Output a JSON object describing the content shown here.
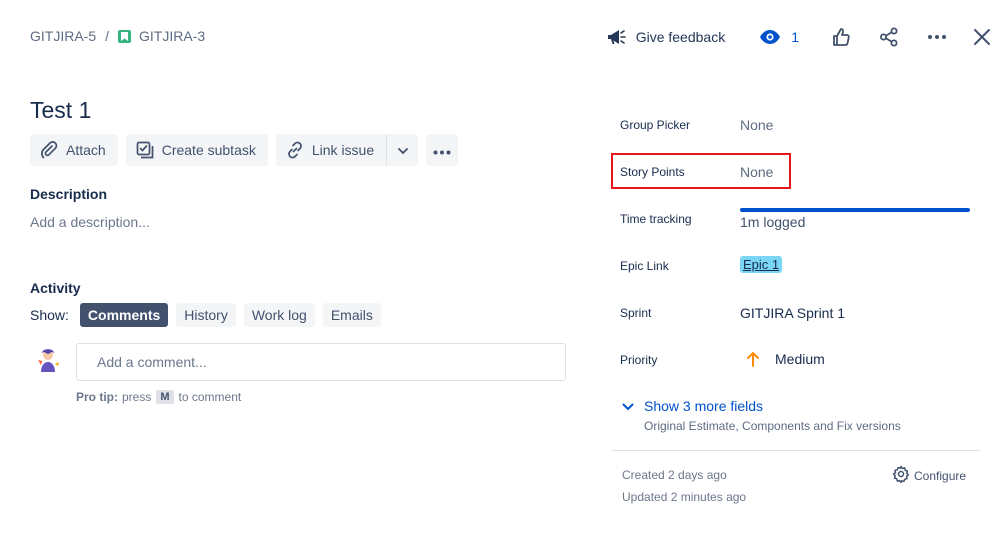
{
  "breadcrumb": {
    "parent": "GITJIRA-5",
    "separator": "/",
    "current": "GITJIRA-3"
  },
  "toolbar": {
    "feedback_label": "Give feedback",
    "watch_count": "1"
  },
  "issue": {
    "title": "Test 1"
  },
  "actions": {
    "attach": "Attach",
    "create_subtask": "Create subtask",
    "link_issue": "Link issue"
  },
  "description": {
    "heading": "Description",
    "placeholder": "Add a description..."
  },
  "activity": {
    "heading": "Activity",
    "show_label": "Show:",
    "tabs": [
      {
        "label": "Comments",
        "active": true
      },
      {
        "label": "History",
        "active": false
      },
      {
        "label": "Work log",
        "active": false
      },
      {
        "label": "Emails",
        "active": false
      }
    ],
    "comment_placeholder": "Add a comment...",
    "protip_label": "Pro tip:",
    "protip_press": "press",
    "protip_key": "M",
    "protip_suffix": "to comment"
  },
  "fields": {
    "group_picker": {
      "label": "Group Picker",
      "value": "None"
    },
    "story_points": {
      "label": "Story Points",
      "value": "None"
    },
    "time_tracking": {
      "label": "Time tracking",
      "value": "1m logged",
      "progress": 1.0
    },
    "epic_link": {
      "label": "Epic Link",
      "value": "Epic 1"
    },
    "sprint": {
      "label": "Sprint",
      "value": "GITJIRA Sprint 1"
    },
    "priority": {
      "label": "Priority",
      "value": "Medium"
    }
  },
  "more_fields": {
    "label": "Show 3 more fields",
    "sub": "Original Estimate, Components and Fix versions"
  },
  "meta": {
    "created": "Created 2 days ago",
    "updated": "Updated 2 minutes ago",
    "configure": "Configure"
  },
  "colors": {
    "accent": "#0052cc",
    "highlight_border": "#e8141c",
    "epic_bg": "#7bd5f5",
    "priority_medium": "#ff8b00",
    "story_icon": "#36b37e"
  }
}
